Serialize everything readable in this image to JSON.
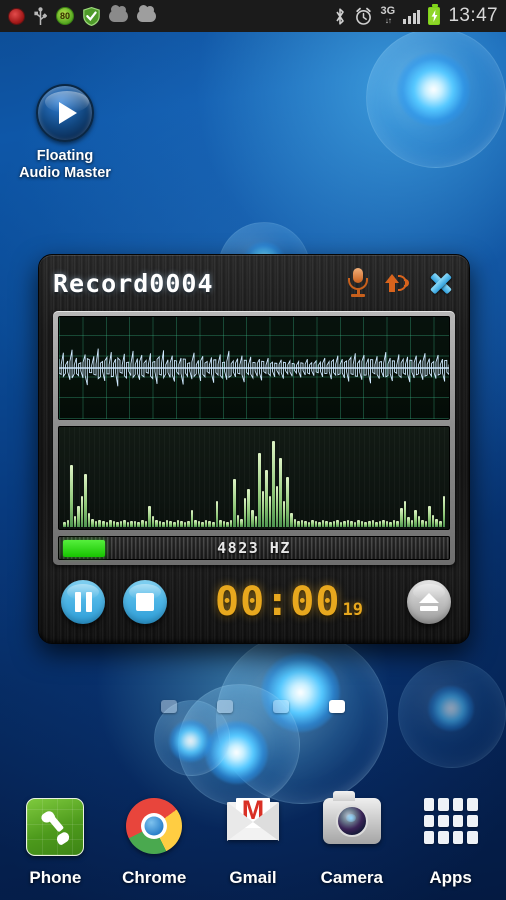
{
  "statusbar": {
    "icons_left": [
      {
        "name": "record-indicator-icon",
        "label": "rec"
      },
      {
        "name": "usb-icon",
        "label": "usb"
      },
      {
        "name": "battery-percent-badge-icon",
        "label": "80"
      },
      {
        "name": "security-shield-icon",
        "label": "shield"
      },
      {
        "name": "cloud-icon",
        "label": "cloud"
      },
      {
        "name": "cloud-sync-icon",
        "label": "cloud2"
      }
    ],
    "icons_right": [
      {
        "name": "bluetooth-icon",
        "label": "bt"
      },
      {
        "name": "alarm-clock-icon",
        "label": "alarm"
      },
      {
        "name": "network-type-icon",
        "label": "3G"
      },
      {
        "name": "signal-bars-icon",
        "label": "signal"
      },
      {
        "name": "battery-charging-icon",
        "label": "battery"
      }
    ],
    "network_type": "3G",
    "clock": "13:47"
  },
  "home": {
    "shortcut": {
      "label_line1": "Floating",
      "label_line2": "Audio Master",
      "icon": "play-circle-icon"
    },
    "page_indicator": {
      "count": 4,
      "active_index": 3
    }
  },
  "audio_window": {
    "title": "Record0004",
    "titlebar_actions": [
      {
        "name": "microphone-source-button",
        "icon": "microphone-icon"
      },
      {
        "name": "output-speaker-button",
        "icon": "speaker-up-icon"
      },
      {
        "name": "close-window-button",
        "icon": "close-x-icon"
      }
    ],
    "frequency_readout": "4823 HZ",
    "frequency_led_color": "#2fe21a",
    "timer": {
      "main": "00:00",
      "fraction": "19",
      "color": "#e8a81e"
    },
    "transport": [
      {
        "name": "pause-button",
        "icon": "pause-icon",
        "color": "#4fb6e6"
      },
      {
        "name": "stop-button",
        "icon": "stop-icon",
        "color": "#4fb6e6"
      },
      {
        "name": "eject-button",
        "icon": "eject-icon",
        "color": "#c4c4c4"
      }
    ],
    "waveform": {
      "type": "oscilloscope",
      "grid_color": "#3cbe8c",
      "trace_color": "#cfe9ff",
      "background": "#07120d",
      "samples": [
        0.3,
        -0.22,
        0.52,
        -0.18,
        0.24,
        -0.4,
        0.62,
        -0.2,
        0.34,
        -0.26,
        0.18,
        -0.34,
        0.46,
        -0.58,
        0.28,
        -0.16,
        0.4,
        -0.24,
        0.66,
        -0.3,
        0.22,
        -0.44,
        0.36,
        -0.2,
        0.54,
        -0.28,
        0.3,
        -0.62,
        0.26,
        -0.18,
        0.48,
        -0.34,
        0.2,
        -0.26,
        0.58,
        -0.22,
        0.32,
        -0.4,
        0.44,
        -0.3,
        0.26,
        -0.18,
        0.5,
        -0.36,
        0.22,
        -0.54,
        0.38,
        -0.24,
        0.6,
        -0.2,
        0.28,
        -0.32,
        0.42,
        -0.46,
        0.24,
        -0.22,
        0.34,
        -0.56,
        0.3,
        -0.28,
        0.18,
        -0.38,
        0.52,
        -0.2,
        0.26,
        -0.44,
        0.4,
        -0.3,
        0.22,
        -0.18,
        0.36,
        -0.5,
        0.28,
        -0.24,
        0.46,
        -0.34,
        0.2,
        -0.4,
        0.58,
        -0.26,
        0.24,
        -0.3,
        0.32,
        -0.2,
        0.42,
        -0.48,
        0.26,
        -0.22,
        0.38,
        -0.34,
        0.18,
        -0.28,
        0.3,
        -0.42,
        0.22,
        -0.18,
        0.34,
        -0.26,
        0.2,
        -0.3,
        0.16,
        -0.22,
        0.28,
        -0.36,
        0.18,
        -0.2,
        0.24,
        -0.28,
        0.14,
        -0.18,
        0.22,
        -0.32,
        0.16,
        -0.24,
        0.3,
        -0.2,
        0.18,
        -0.26,
        0.24,
        -0.16,
        0.2,
        -0.3,
        0.34,
        -0.18,
        0.22,
        -0.38,
        0.28,
        -0.24,
        0.42,
        -0.2,
        0.3,
        -0.34,
        0.24,
        -0.46,
        0.36,
        -0.22,
        0.5,
        -0.28,
        0.26,
        -0.4,
        0.44,
        -0.24,
        0.32,
        -0.52,
        0.28,
        -0.2,
        0.4,
        -0.36,
        0.22,
        -0.3,
        0.54,
        -0.26,
        0.34,
        -0.44,
        0.24,
        -0.18,
        0.46,
        -0.32,
        0.3,
        -0.22,
        0.38,
        -0.48,
        0.26,
        -0.34,
        0.42,
        -0.2,
        0.28,
        -0.4,
        0.5,
        -0.24,
        0.32,
        -0.28,
        0.22,
        -0.36,
        0.44,
        -0.2,
        0.3,
        -0.46,
        0.26,
        -0.22
      ]
    },
    "spectrum": {
      "type": "bar",
      "bar_color": "#9fd189",
      "background": "#121a14",
      "values": [
        4,
        6,
        52,
        9,
        18,
        26,
        44,
        12,
        7,
        5,
        6,
        5,
        4,
        6,
        5,
        4,
        5,
        6,
        4,
        5,
        5,
        4,
        6,
        5,
        18,
        9,
        6,
        5,
        4,
        6,
        5,
        4,
        6,
        5,
        4,
        5,
        14,
        6,
        5,
        4,
        6,
        5,
        4,
        22,
        6,
        5,
        4,
        6,
        40,
        10,
        7,
        24,
        32,
        14,
        9,
        62,
        30,
        48,
        26,
        72,
        34,
        58,
        22,
        42,
        12,
        7,
        5,
        6,
        5,
        4,
        6,
        5,
        4,
        6,
        5,
        4,
        5,
        6,
        4,
        5,
        6,
        5,
        4,
        6,
        5,
        4,
        5,
        6,
        4,
        5,
        6,
        5,
        4,
        6,
        5,
        16,
        22,
        8,
        6,
        14,
        9,
        6,
        5,
        18,
        10,
        7,
        5,
        26
      ]
    }
  },
  "dock": {
    "items": [
      {
        "name": "dock-item-phone",
        "label": "Phone",
        "icon": "phone-icon"
      },
      {
        "name": "dock-item-chrome",
        "label": "Chrome",
        "icon": "chrome-icon"
      },
      {
        "name": "dock-item-gmail",
        "label": "Gmail",
        "icon": "gmail-icon"
      },
      {
        "name": "dock-item-camera",
        "label": "Camera",
        "icon": "camera-icon"
      },
      {
        "name": "dock-item-apps",
        "label": "Apps",
        "icon": "apps-grid-icon"
      }
    ]
  }
}
